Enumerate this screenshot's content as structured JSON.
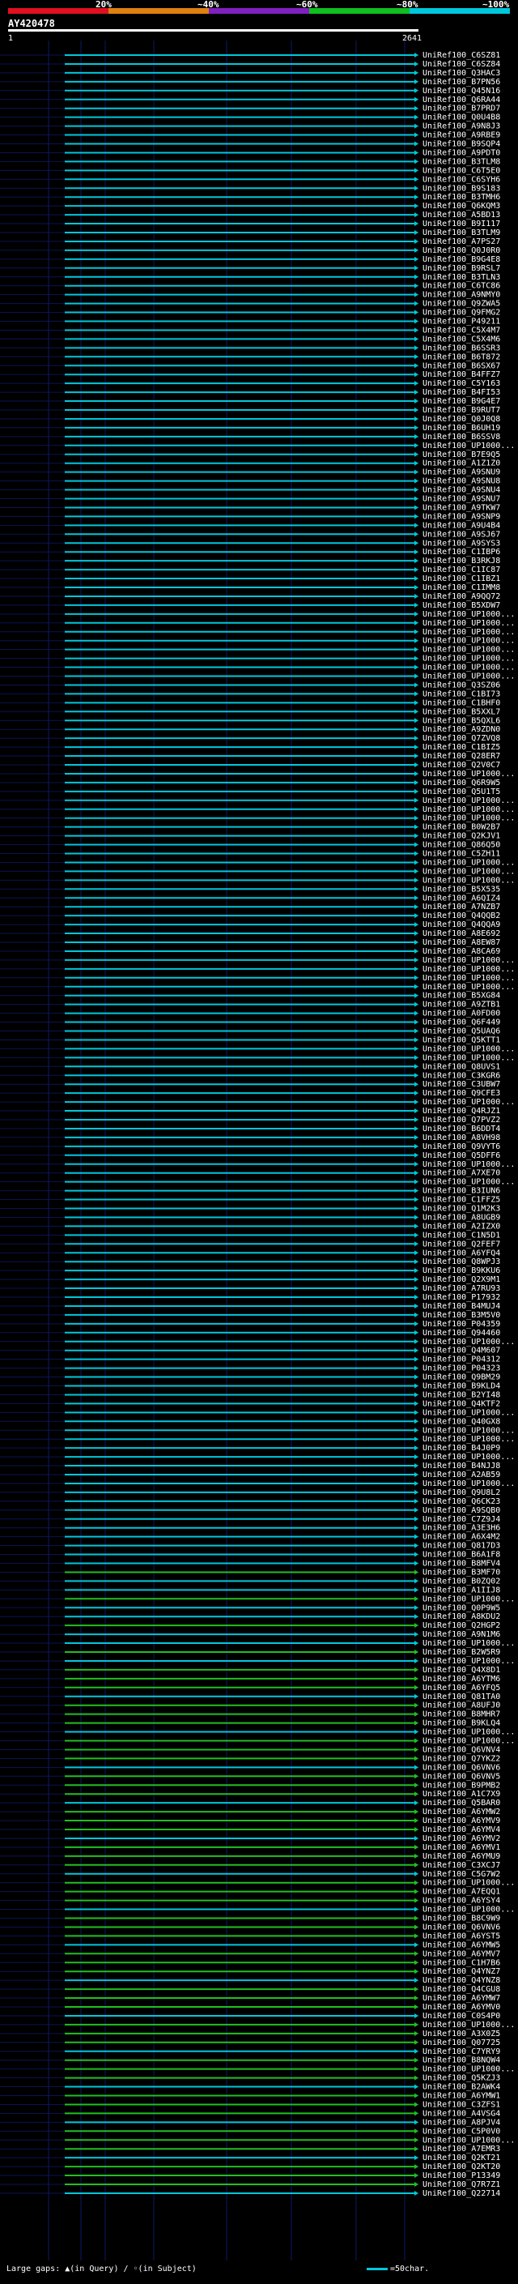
{
  "legend": {
    "labels": [
      "20%",
      "~40%",
      "~60%",
      "~80%",
      "~100%"
    ],
    "colors": [
      "#e01020",
      "#e08010",
      "#8020c0",
      "#10c020",
      "#00c8dc"
    ]
  },
  "query": {
    "title": "AY420478",
    "range_start": "1",
    "range_end": "2641",
    "length": 2641
  },
  "footer": {
    "large_gaps_label": "Large gaps: ▲(in Query) / ◦(in Subject)",
    "scale_label": "=50char."
  },
  "hits": [
    "UniRef100_C6SZ81",
    "UniRef100_C6SZ84",
    "UniRef100_Q3HAC3",
    "UniRef100_B7PN56",
    "UniRef100_Q45N16",
    "UniRef100_Q6RA44",
    "UniRef100_B7PRD7",
    "UniRef100_Q0U4B8",
    "UniRef100_A9N8J3",
    "UniRef100_A9RBE9",
    "UniRef100_B9SQP4",
    "UniRef100_A9PDT0",
    "UniRef100_B3TLM8",
    "UniRef100_C6T5E0",
    "UniRef100_C6SYH6",
    "UniRef100_B9S183",
    "UniRef100_B3TMH6",
    "UniRef100_Q6KQM3",
    "UniRef100_A5BD13",
    "UniRef100_B9I117",
    "UniRef100_B3TLM9",
    "UniRef100_A7PS27",
    "UniRef100_Q0J0R0",
    "UniRef100_B9G4E8",
    "UniRef100_B9RSL7",
    "UniRef100_B3TLN3",
    "UniRef100_C6TC86",
    "UniRef100_A9NMY0",
    "UniRef100_Q9ZWA5",
    "UniRef100_Q9FMG2",
    "UniRef100_P49211",
    "UniRef100_C5X4M7",
    "UniRef100_C5X4M6",
    "UniRef100_B6SSR3",
    "UniRef100_B6T872",
    "UniRef100_B6SX67",
    "UniRef100_B4FFZ7",
    "UniRef100_C5Y163",
    "UniRef100_B4FI53",
    "UniRef100_B9G4E7",
    "UniRef100_B9RUT7",
    "UniRef100_Q0J0Q8",
    "UniRef100_B6UH19",
    "UniRef100_B6SSV8",
    "UniRef100_UP1000...",
    "UniRef100_B7E9Q5",
    "UniRef100_A1Z1Z0",
    "UniRef100_A9SNU9",
    "UniRef100_A9SNU8",
    "UniRef100_A9SNU4",
    "UniRef100_A9SNU7",
    "UniRef100_A9TKW7",
    "UniRef100_A9SNP9",
    "UniRef100_A9U4B4",
    "UniRef100_A9SJ67",
    "UniRef100_A9SYS3",
    "UniRef100_C1IBP6",
    "UniRef100_B3RKJ8",
    "UniRef100_C1IC87",
    "UniRef100_C1IBZ1",
    "UniRef100_C1IMM8",
    "UniRef100_A9QQ72",
    "UniRef100_B5XDW7",
    "UniRef100_UP1000...",
    "UniRef100_UP1000...",
    "UniRef100_UP1000...",
    "UniRef100_UP1000...",
    "UniRef100_UP1000...",
    "UniRef100_UP1000...",
    "UniRef100_UP1000...",
    "UniRef100_UP1000...",
    "UniRef100_Q3SZ06",
    "UniRef100_C1BI73",
    "UniRef100_C1BHF0",
    "UniRef100_B5XXL7",
    "UniRef100_B5QXL6",
    "UniRef100_A9ZDN0",
    "UniRef100_Q7ZVQ8",
    "UniRef100_C1BIZ5",
    "UniRef100_Q28ER7",
    "UniRef100_Q2V0C7",
    "UniRef100_UP1000...",
    "UniRef100_Q6R9W5",
    "UniRef100_Q5U1T5",
    "UniRef100_UP1000...",
    "UniRef100_UP1000...",
    "UniRef100_UP1000...",
    "UniRef100_B0W2B7",
    "UniRef100_Q2KJV1",
    "UniRef100_Q86Q50",
    "UniRef100_C5ZH11",
    "UniRef100_UP1000...",
    "UniRef100_UP1000...",
    "UniRef100_UP1000...",
    "UniRef100_B5X535",
    "UniRef100_A6QIZ4",
    "UniRef100_A7NZB7",
    "UniRef100_Q4QQB2",
    "UniRef100_Q4QQA9",
    "UniRef100_A8E692",
    "UniRef100_A8EW87",
    "UniRef100_A8CA69",
    "UniRef100_UP1000...",
    "UniRef100_UP1000...",
    "UniRef100_UP1000...",
    "UniRef100_UP1000...",
    "UniRef100_B5XG84",
    "UniRef100_A9ZTB1",
    "UniRef100_A0FD00",
    "UniRef100_Q6F449",
    "UniRef100_Q5UAQ6",
    "UniRef100_Q5KTT1",
    "UniRef100_UP1000...",
    "UniRef100_UP1000...",
    "UniRef100_Q8UVS1",
    "UniRef100_C3KGR6",
    "UniRef100_C3UBW7",
    "UniRef100_Q9CFE3",
    "UniRef100_UP1000...",
    "UniRef100_Q4RJZ1",
    "UniRef100_Q7PVZ2",
    "UniRef100_B6DDT4",
    "UniRef100_A8VH98",
    "UniRef100_Q9VYT6",
    "UniRef100_Q5DFF6",
    "UniRef100_UP1000...",
    "UniRef100_A7XE70",
    "UniRef100_UP1000...",
    "UniRef100_B3IUN6",
    "UniRef100_C1FFZ5",
    "UniRef100_Q1M2K3",
    "UniRef100_A8UGB9",
    "UniRef100_A2IZX0",
    "UniRef100_C1N5D1",
    "UniRef100_Q2FEF7",
    "UniRef100_A6YFQ4",
    "UniRef100_Q8WPJ3",
    "UniRef100_B9KKU6",
    "UniRef100_Q2X9M1",
    "UniRef100_A7RU93",
    "UniRef100_P17932",
    "UniRef100_B4MUJ4",
    "UniRef100_B3M5V0",
    "UniRef100_P04359",
    "UniRef100_Q94460",
    "UniRef100_UP1000...",
    "UniRef100_Q4M607",
    "UniRef100_P04312",
    "UniRef100_P04323",
    "UniRef100_Q9BM29",
    "UniRef100_B9KLD4",
    "UniRef100_B2YI48",
    "UniRef100_Q4KTF2",
    "UniRef100_UP1000...",
    "UniRef100_Q40GX8",
    "UniRef100_UP1000...",
    "UniRef100_UP1000...",
    "UniRef100_B4J0P9",
    "UniRef100_UP1000...",
    "UniRef100_B4NJJ8",
    "UniRef100_A2AB59",
    "UniRef100_UP1000...",
    "UniRef100_Q9U8L2",
    "UniRef100_Q6CK23",
    "UniRef100_A9SQB0",
    "UniRef100_C7Z9J4",
    "UniRef100_A3E3H6",
    "UniRef100_A6X4M2",
    "UniRef100_Q817D3",
    "UniRef100_B6A1F8",
    "UniRef100_B8MFV4",
    "UniRef100_B3MF70",
    "UniRef100_B0ZQ02",
    "UniRef100_A1IIJ8",
    "UniRef100_UP1000...",
    "UniRef100_Q0P9W5",
    "UniRef100_A8KDU2",
    "UniRef100_Q2HGP2",
    "UniRef100_A9N1M6",
    "UniRef100_UP1000...",
    "UniRef100_B2W5R9",
    "UniRef100_UP1000...",
    "UniRef100_Q4X8D1",
    "UniRef100_A6YTM6",
    "UniRef100_A6YFQ5",
    "UniRef100_Q81TA0",
    "UniRef100_A8UFJ0",
    "UniRef100_B8MHR7",
    "UniRef100_B9KLQ4",
    "UniRef100_UP1000...",
    "UniRef100_UP1000...",
    "UniRef100_Q6VNV4",
    "UniRef100_Q7YKZ2",
    "UniRef100_Q6VNV6",
    "UniRef100_Q6VNV5",
    "UniRef100_B9PMB2",
    "UniRef100_A1C7X9",
    "UniRef100_Q5BAR0",
    "UniRef100_A6YMW2",
    "UniRef100_A6YMV9",
    "UniRef100_A6YMV4",
    "UniRef100_A6YMV2",
    "UniRef100_A6YMV1",
    "UniRef100_A6YMU9",
    "UniRef100_C3XCJ7",
    "UniRef100_C5G7W2",
    "UniRef100_UP1000...",
    "UniRef100_A7EQQ1",
    "UniRef100_A6YSY4",
    "UniRef100_UP1000...",
    "UniRef100_B8C9W9",
    "UniRef100_Q6VNV6",
    "UniRef100_A6YST5",
    "UniRef100_A6YMW5",
    "UniRef100_A6YMV7",
    "UniRef100_C1H7B6",
    "UniRef100_Q4YNZ7",
    "UniRef100_Q4YNZ8",
    "UniRef100_Q4CGU8",
    "UniRef100_A6YMW7",
    "UniRef100_A6YMV0",
    "UniRef100_C0S4P0",
    "UniRef100_UP1000...",
    "UniRef100_A3X0Z5",
    "UniRef100_Q07725",
    "UniRef100_C7YRY9",
    "UniRef100_B8NQW4",
    "UniRef100_UP1000...",
    "UniRef100_Q5KZJ3",
    "UniRef100_B2AWK4",
    "UniRef100_A6YMW1",
    "UniRef100_C3ZFS1",
    "UniRef100_A4VSG4",
    "UniRef100_A8PJV4",
    "UniRef100_C5P0V0",
    "UniRef100_UP1000...",
    "UniRef100_A7EMR3",
    "UniRef100_Q2KT21",
    "UniRef100_Q2KT20",
    "UniRef100_P13349",
    "UniRef100_Q7R7Z1",
    "UniRef100_Q22714"
  ]
}
